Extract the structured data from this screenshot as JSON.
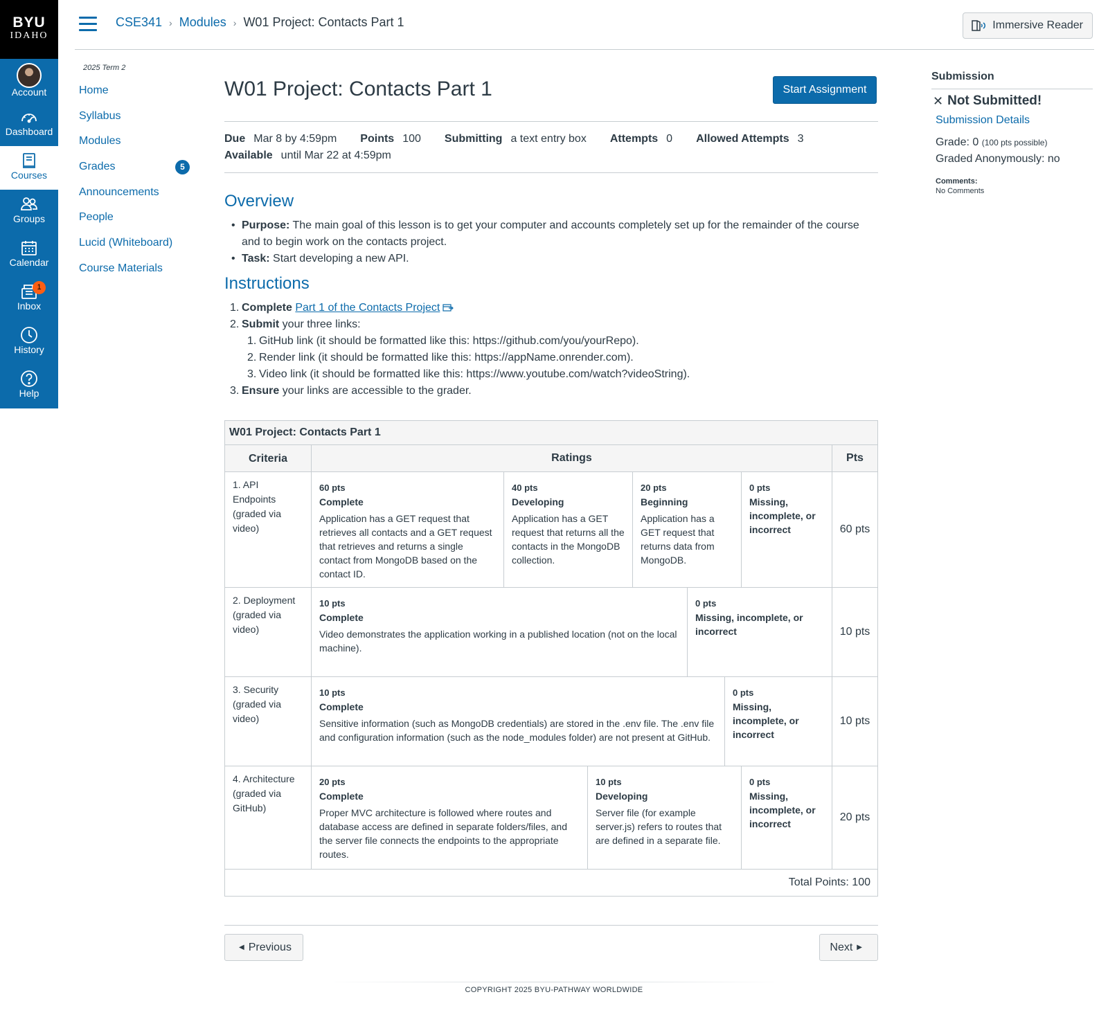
{
  "logo": {
    "line1": "BYU",
    "line2": "IDAHO"
  },
  "global_nav": [
    {
      "label": "Account",
      "icon": "avatar"
    },
    {
      "label": "Dashboard",
      "icon": "dashboard-icon"
    },
    {
      "label": "Courses",
      "icon": "courses-icon"
    },
    {
      "label": "Groups",
      "icon": "groups-icon"
    },
    {
      "label": "Calendar",
      "icon": "calendar-icon"
    },
    {
      "label": "Inbox",
      "icon": "inbox-icon",
      "badge": "1"
    },
    {
      "label": "History",
      "icon": "history-icon"
    },
    {
      "label": "Help",
      "icon": "help-icon"
    }
  ],
  "breadcrumb": {
    "course": "CSE341",
    "section": "Modules",
    "current": "W01 Project: Contacts Part 1",
    "separator": "›"
  },
  "immersive_reader": "Immersive Reader",
  "course_nav": {
    "term": "2025 Term 2",
    "items": [
      "Home",
      "Syllabus",
      "Modules",
      "Grades",
      "Announcements",
      "People",
      "Lucid (Whiteboard)",
      "Course Materials"
    ],
    "grades_badge": "5"
  },
  "assignment": {
    "title": "W01 Project: Contacts Part 1",
    "start_button": "Start Assignment",
    "details": {
      "due_label": "Due",
      "due": "Mar 8 by 4:59pm",
      "points_label": "Points",
      "points": "100",
      "submitting_label": "Submitting",
      "submitting": "a text entry box",
      "attempts_label": "Attempts",
      "attempts": "0",
      "allowed_label": "Allowed Attempts",
      "allowed": "3",
      "available_label": "Available",
      "available": "until Mar 22 at 4:59pm"
    },
    "overview": {
      "heading": "Overview",
      "items": [
        {
          "label": "Purpose:",
          "text": " The main goal of this lesson is to get your computer and accounts completely set up for the remainder of the course and to begin work on the contacts project."
        },
        {
          "label": "Task:",
          "text": " Start developing a new API."
        }
      ]
    },
    "instructions": {
      "heading": "Instructions",
      "step1_bold": "Complete",
      "step1_link": "Part 1 of the Contacts Project",
      "step2_bold": "Submit",
      "step2_text": " your three links:",
      "sub": [
        "GitHub link (it should be formatted like this: https://github.com/you/yourRepo).",
        "Render link (it should be formatted like this: https://appName.onrender.com).",
        "Video link (it should be formatted like this: https://www.youtube.com/watch?videoString)."
      ],
      "step3_bold": "Ensure",
      "step3_text": " your links are accessible to the grader."
    }
  },
  "rubric": {
    "title": "W01 Project: Contacts Part 1",
    "headers": {
      "criteria": "Criteria",
      "ratings": "Ratings",
      "pts": "Pts"
    },
    "criteria": [
      {
        "name": "1. API Endpoints (graded via video)",
        "pts": "60 pts",
        "ratings": [
          {
            "pts": "60 pts",
            "name": "Complete",
            "desc": "Application has a GET request that retrieves all contacts and a GET request that retrieves and returns a single contact from MongoDB based on the contact ID."
          },
          {
            "pts": "40 pts",
            "name": "Developing",
            "desc": "Application has a GET request that returns all the contacts in the MongoDB collection."
          },
          {
            "pts": "20 pts",
            "name": "Beginning",
            "desc": "Application has a GET request that returns data from MongoDB."
          },
          {
            "pts": "0 pts",
            "name": "Missing, incomplete, or incorrect",
            "desc": ""
          }
        ]
      },
      {
        "name": "2. Deployment (graded via video)",
        "pts": "10 pts",
        "ratings": [
          {
            "pts": "10 pts",
            "name": "Complete",
            "desc": "Video demonstrates the application working in a published location (not on the local machine)."
          },
          {
            "pts": "0 pts",
            "name": "Missing, incomplete, or incorrect",
            "desc": ""
          }
        ]
      },
      {
        "name": "3. Security (graded via video)",
        "pts": "10 pts",
        "ratings": [
          {
            "pts": "10 pts",
            "name": "Complete",
            "desc": "Sensitive information (such as MongoDB credentials) are stored in the .env file. The .env file and configuration information (such as the node_modules folder) are not present at GitHub."
          },
          {
            "pts": "0 pts",
            "name": "Missing, incomplete, or incorrect",
            "desc": ""
          }
        ]
      },
      {
        "name": "4. Architecture (graded via GitHub)",
        "pts": "20 pts",
        "ratings": [
          {
            "pts": "20 pts",
            "name": "Complete",
            "desc": "Proper MVC architecture is followed where routes and database access are defined in separate folders/files, and the server file connects the endpoints to the appropriate routes."
          },
          {
            "pts": "10 pts",
            "name": "Developing",
            "desc": "Server file (for example server.js) refers to routes that are defined in a separate file."
          },
          {
            "pts": "0 pts",
            "name": "Missing, incomplete, or incorrect",
            "desc": ""
          }
        ]
      }
    ],
    "total": "Total Points: 100"
  },
  "pager": {
    "previous": "Previous",
    "next": "Next"
  },
  "footer": {
    "copyright": "COPYRIGHT 2025 BYU-PATHWAY WORLDWIDE"
  },
  "sidebar": {
    "title": "Submission",
    "status": "Not Submitted!",
    "details_link": "Submission Details",
    "grade_label": "Grade: 0",
    "grade_possible": "(100 pts possible)",
    "anonymous": "Graded Anonymously: no",
    "comments_label": "Comments:",
    "comments": "No Comments"
  },
  "colors": {
    "brand": "#0c6bab",
    "logo_bg": "#000000",
    "badge": "#fc5e13",
    "border": "#c7cdd1"
  }
}
